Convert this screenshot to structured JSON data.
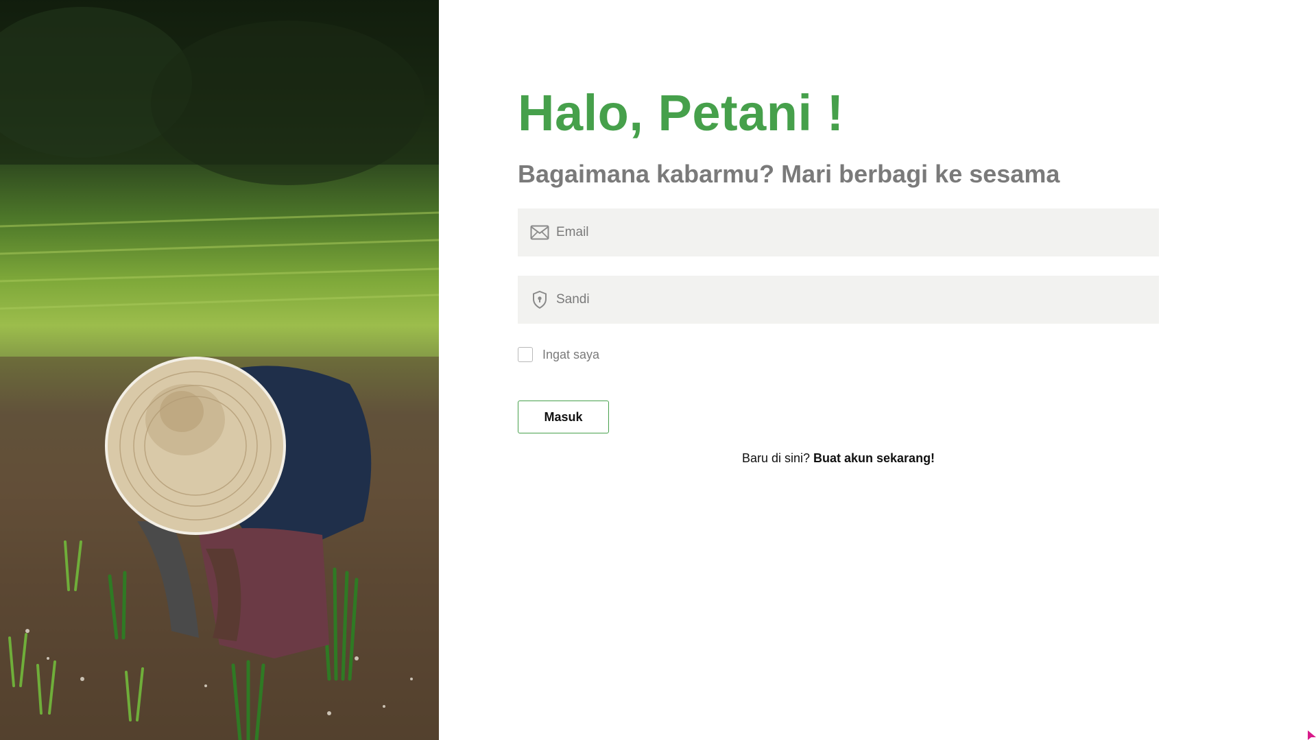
{
  "hero_image": {
    "description_icon": "photo-farmer-planting-rice"
  },
  "login": {
    "greeting": "Halo, Petani !",
    "subtitle": "Bagaimana kabarmu? Mari berbagi ke sesama",
    "email": {
      "placeholder": "Email",
      "value": "",
      "icon": "envelope-icon"
    },
    "password": {
      "placeholder": "Sandi",
      "value": "",
      "icon": "shield-lock-icon"
    },
    "remember_label": "Ingat saya",
    "remember_checked": false,
    "submit_label": "Masuk",
    "signup_prompt": "Baru di sini?",
    "signup_link": "Buat akun sekarang!"
  },
  "colors": {
    "accent": "#46a04b",
    "field_bg": "#f2f2f0",
    "subtitle": "#7a7a7a"
  }
}
